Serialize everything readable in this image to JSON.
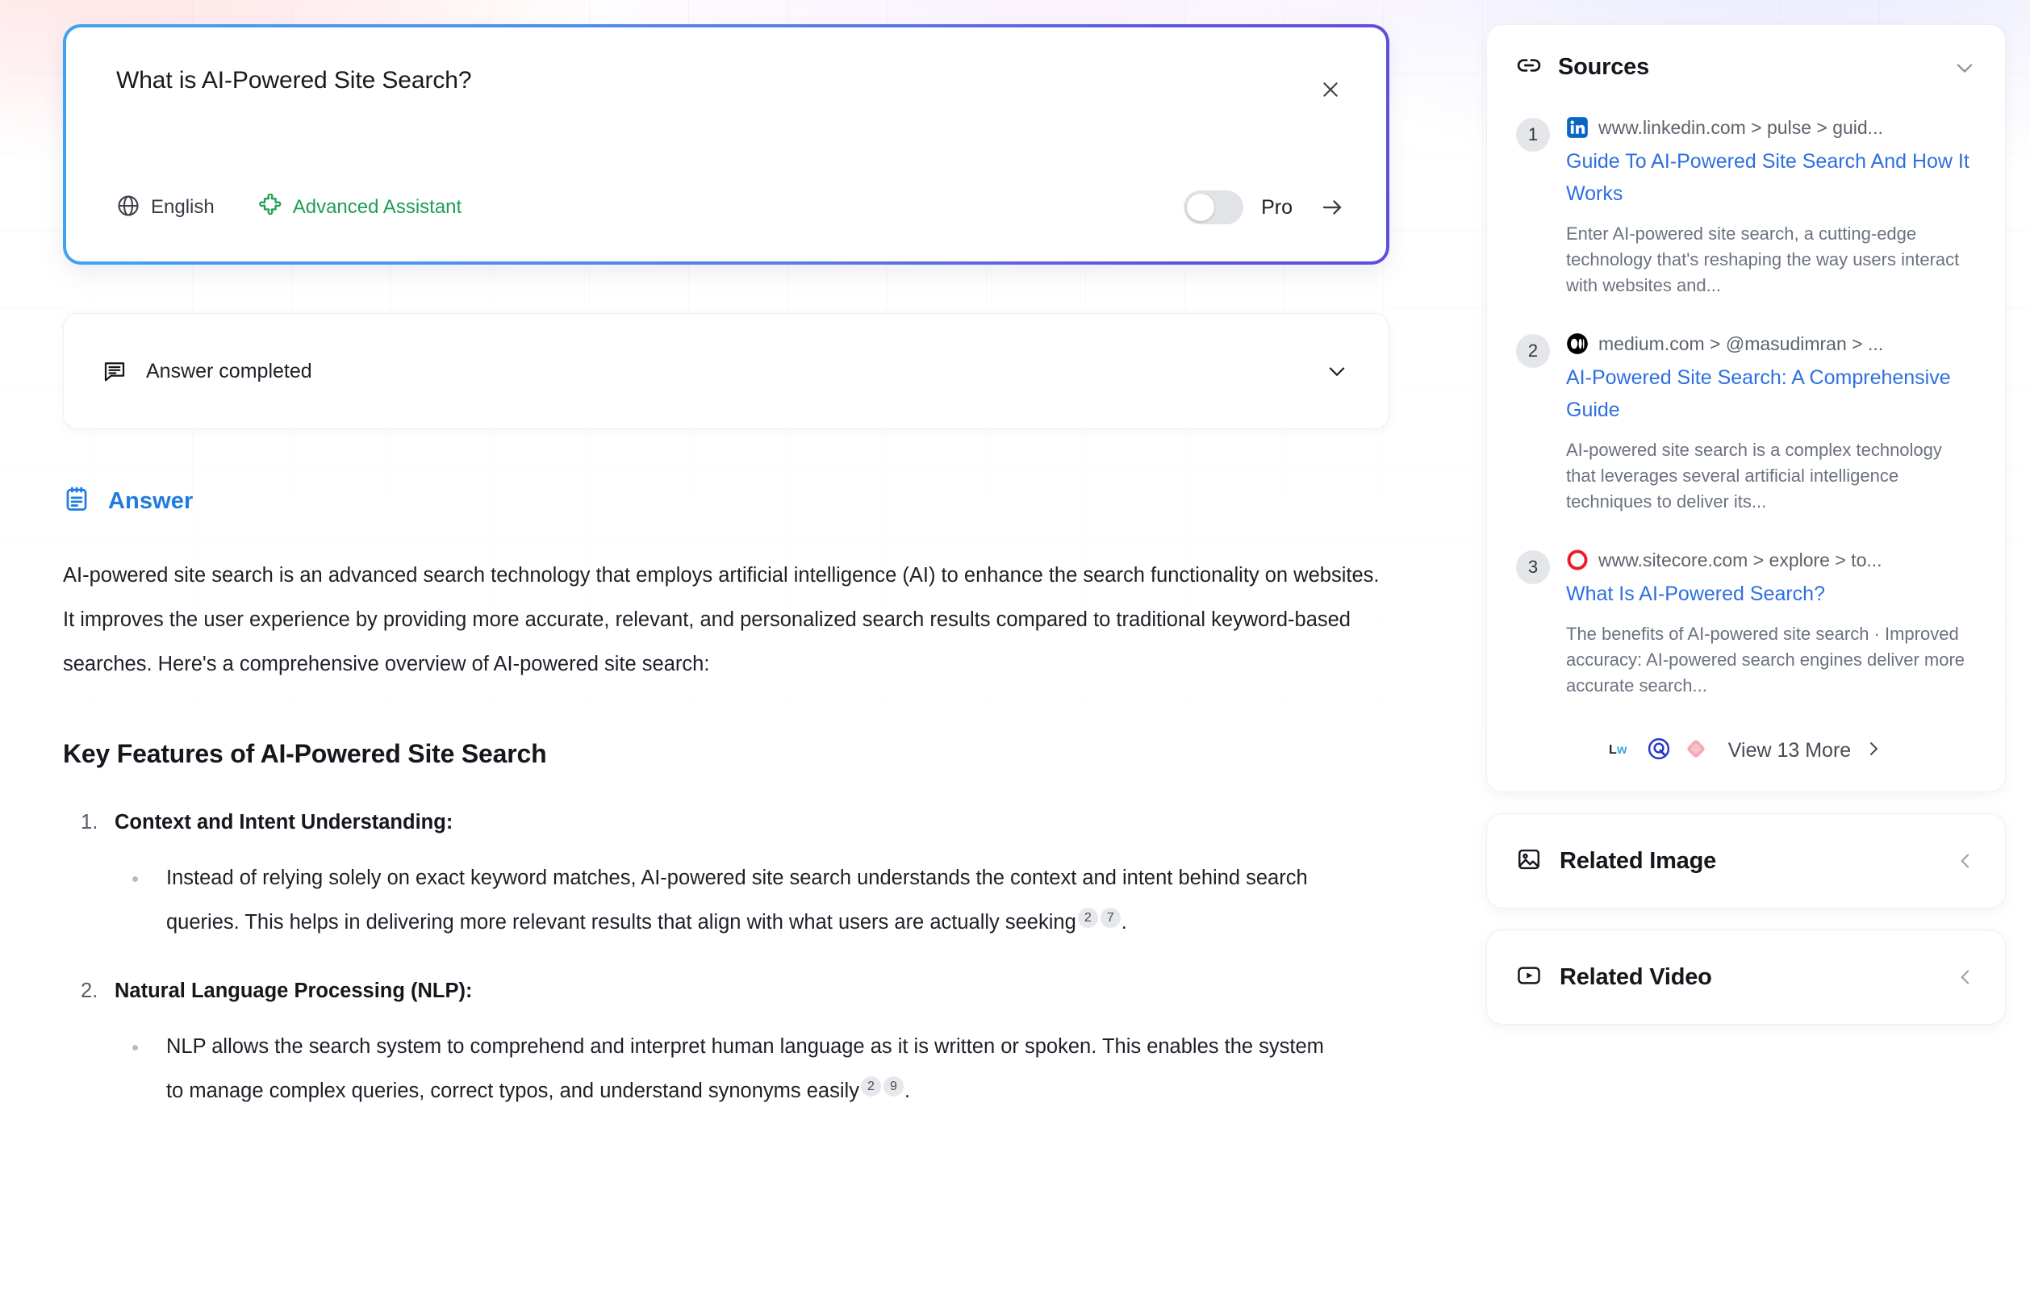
{
  "search": {
    "query": "What is AI-Powered Site Search?",
    "close_icon": "close-icon",
    "language_label": "English",
    "language_icon": "globe-icon",
    "assistant_label": "Advanced Assistant",
    "assistant_icon": "puzzle-piece-icon",
    "assistant_color": "#1e9e52",
    "pro_label": "Pro",
    "pro_enabled": false,
    "submit_icon": "arrow-right-icon",
    "border_gradient_from": "#3FA3F0",
    "border_gradient_to": "#5D4FDD"
  },
  "status": {
    "icon": "message-lines-icon",
    "text": "Answer completed",
    "chevron_icon": "chevron-down-icon"
  },
  "answer": {
    "icon": "notepad-icon",
    "title": "Answer",
    "title_color": "#1F7BE0",
    "intro": "AI-powered site search is an advanced search technology that employs artificial intelligence (AI) to enhance the search functionality on websites. It improves the user experience by providing more accurate, relevant, and personalized search results compared to traditional keyword-based searches. Here's a comprehensive overview of AI-powered site search:",
    "features_heading": "Key Features of AI-Powered Site Search",
    "features": [
      {
        "title": "Context and Intent Understanding",
        "colon": ":",
        "bullet_lead": "Instead of relying solely on exact keyword matches, AI-powered site search understands the context and intent behind search queries. This helps in delivering more relevant results that align with what users are actually seeking",
        "citations": [
          "2",
          "7"
        ],
        "bullet_tail": "."
      },
      {
        "title": "Natural Language Processing (NLP)",
        "colon": ":",
        "bullet_lead": "NLP allows the search system to comprehend and interpret human language as it is written or spoken. This enables the system to manage complex queries, correct typos, and understand synonyms easily",
        "citations": [
          "2",
          "9"
        ],
        "bullet_tail": "."
      }
    ]
  },
  "sidebar": {
    "sources": {
      "icon": "link-icon",
      "title": "Sources",
      "chevron_icon": "chevron-down-icon",
      "items": [
        {
          "number": "1",
          "favicon": "linkedin-icon",
          "url": "www.linkedin.com > pulse > guid...",
          "title": "Guide To AI-Powered Site Search And How It Works",
          "snippet": "Enter AI-powered site search, a cutting-edge technology that's reshaping the way users interact with websites and..."
        },
        {
          "number": "2",
          "favicon": "medium-icon",
          "url": "medium.com > @masudimran > ...",
          "title": "AI-Powered Site Search: A Comprehensive Guide",
          "snippet": "AI-powered site search is a complex technology that leverages several artificial intelligence techniques to deliver its..."
        },
        {
          "number": "3",
          "favicon": "sitecore-icon",
          "url": "www.sitecore.com > explore > to...",
          "title": "What Is AI-Powered Search?",
          "snippet": "The benefits of AI-powered site search · Improved accuracy: AI-powered search engines deliver more accurate search..."
        }
      ],
      "view_more": {
        "text": "View 13 More",
        "chevron_icon": "chevron-right-icon",
        "favicons": [
          "lw-icon",
          "q-circle-icon",
          "pink-diamond-icon"
        ]
      }
    },
    "related_image": {
      "icon": "image-icon",
      "title": "Related Image",
      "chevron_icon": "chevron-left-icon"
    },
    "related_video": {
      "icon": "video-play-icon",
      "title": "Related Video",
      "chevron_icon": "chevron-left-icon"
    }
  }
}
